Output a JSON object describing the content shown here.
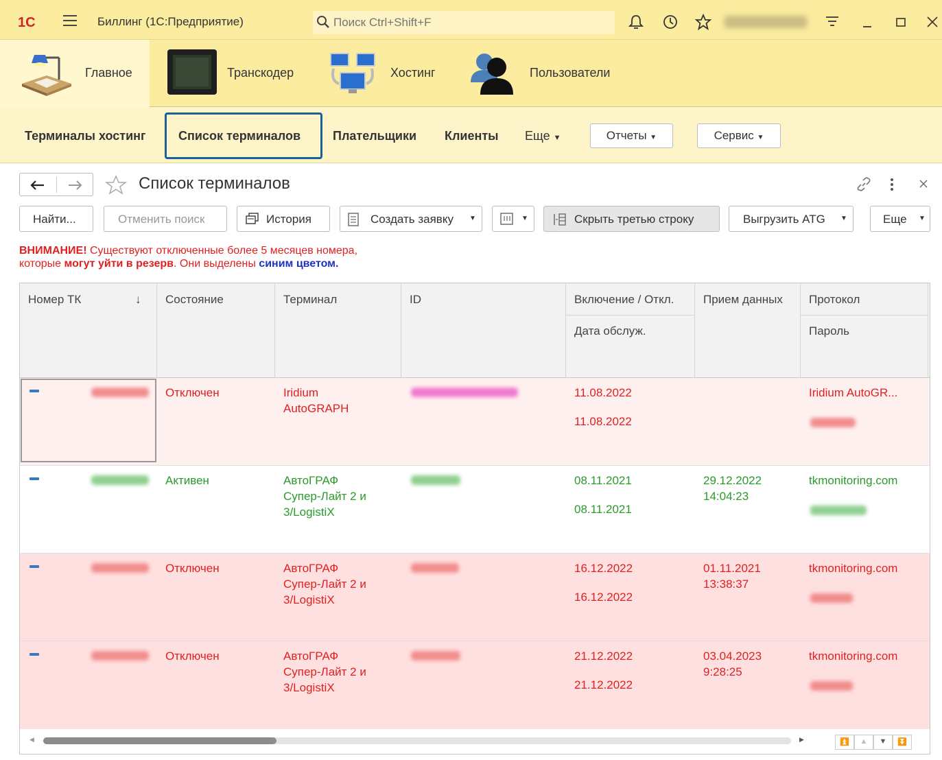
{
  "titlebar": {
    "logo": "1С",
    "app_title": "Биллинг  (1С:Предприятие)",
    "search_placeholder": "Поиск Ctrl+Shift+F"
  },
  "sections": [
    {
      "label": "Главное",
      "icon": "desk-lamp-icon"
    },
    {
      "label": "Транскодер",
      "icon": "monitor-icon"
    },
    {
      "label": "Хостинг",
      "icon": "network-computers-icon"
    },
    {
      "label": "Пользователи",
      "icon": "users-icon"
    }
  ],
  "funcbar": {
    "items": [
      "Терминалы хостинг",
      "Список терминалов",
      "Плательщики",
      "Клиенты"
    ],
    "more": "Еще",
    "reports": "Отчеты",
    "service": "Сервис"
  },
  "form": {
    "title": "Список терминалов"
  },
  "commands": {
    "find": "Найти...",
    "cancel_search": "Отменить поиск",
    "history": "История",
    "create_request": "Создать заявку",
    "hide_third_row": "Скрыть третью строку",
    "export_atg": "Выгрузить ATG",
    "more": "Еще"
  },
  "warning": {
    "attention": "ВНИМАНИЕ!",
    "line1_rest": " Существуют отключенные более 5 месяцев номера,",
    "line2_a": "которые ",
    "line2_bold": "могут уйти в резерв",
    "line2_b": ". Они выделены ",
    "line2_blue": "синим цветом."
  },
  "table": {
    "columns": {
      "number": "Номер ТК",
      "sort_arrow": "↓",
      "state": "Состояние",
      "terminal": "Терминал",
      "id": "ID",
      "enable": "Включение / Откл.",
      "service_date": "Дата обслуж.",
      "data_recv": "Прием данных",
      "protocol": "Протокол",
      "password": "Пароль"
    },
    "rows": [
      {
        "state": "Отключен",
        "terminal_1": "Iridium",
        "terminal_2": "AutoGRAPH",
        "terminal_3": "",
        "enable": "11.08.2022",
        "service": "11.08.2022",
        "recv_1": "",
        "recv_2": "",
        "protocol": "Iridium AutoGR..."
      },
      {
        "state": "Активен",
        "terminal_1": "АвтоГРАФ",
        "terminal_2": "Супер-Лайт 2 и",
        "terminal_3": "3/LogistiX",
        "enable": "08.11.2021",
        "service": "08.11.2021",
        "recv_1": "29.12.2022",
        "recv_2": "14:04:23",
        "protocol": "tkmonitoring.com"
      },
      {
        "state": "Отключен",
        "terminal_1": "АвтоГРАФ",
        "terminal_2": "Супер-Лайт 2 и",
        "terminal_3": "3/LogistiX",
        "enable": "16.12.2022",
        "service": "16.12.2022",
        "recv_1": "01.11.2021",
        "recv_2": "13:38:37",
        "protocol": "tkmonitoring.com"
      },
      {
        "state": "Отключен",
        "terminal_1": "АвтоГРАФ",
        "terminal_2": "Супер-Лайт 2 и",
        "terminal_3": "3/LogistiX",
        "enable": "21.12.2022",
        "service": "21.12.2022",
        "recv_1": "03.04.2023",
        "recv_2": "9:28:25",
        "protocol": "tkmonitoring.com"
      }
    ]
  },
  "colors": {
    "red_text": "#e02020",
    "green_text": "#2a9a2a",
    "row_light_red": "#fff0f0",
    "row_red": "#ffe0e0",
    "accent_blue": "#1b5f98"
  }
}
